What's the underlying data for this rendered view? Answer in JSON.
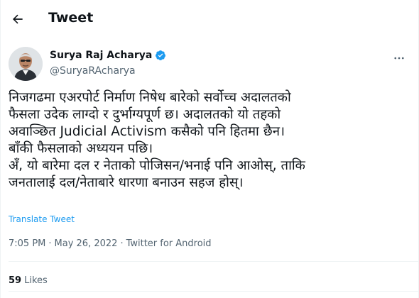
{
  "header": {
    "title": "Tweet",
    "back_icon": "arrow-left-icon"
  },
  "author": {
    "display_name": "Surya Raj Acharya",
    "handle": "@SuryaRAcharya",
    "verified": true,
    "verified_color": "#1d9bf0",
    "more_icon": "more-horizontal-icon"
  },
  "tweet": {
    "lines": [
      "निजगढमा एअरपोर्ट निर्माण निषेध बारेको सर्वोच्च अदालतको",
      "फैसला उदेक लाग्दो र दुर्भाग्यपूर्ण छ। अदालतको यो तहको",
      "अवाञ्छित Judicial Activism कसैको पनि हितमा छैन।",
      "बाँकी फैसलाको अध्ययन पछि।",
      "अँ, यो बारेमा दल र नेताको पोजिसन/भनाई पनि आओस्, ताकि",
      "जनतालाई दल/नेताबारे धारणा बनाउन सहज होस्।"
    ],
    "translate_label": "Translate Tweet",
    "time": "7:05 PM",
    "date": "May 26, 2022",
    "source": "Twitter for Android",
    "separator": "·"
  },
  "stats": {
    "likes_count": "59",
    "likes_label": "Likes"
  },
  "colors": {
    "accent": "#1d9bf0",
    "text": "#0f1419",
    "secondary": "#536471"
  }
}
